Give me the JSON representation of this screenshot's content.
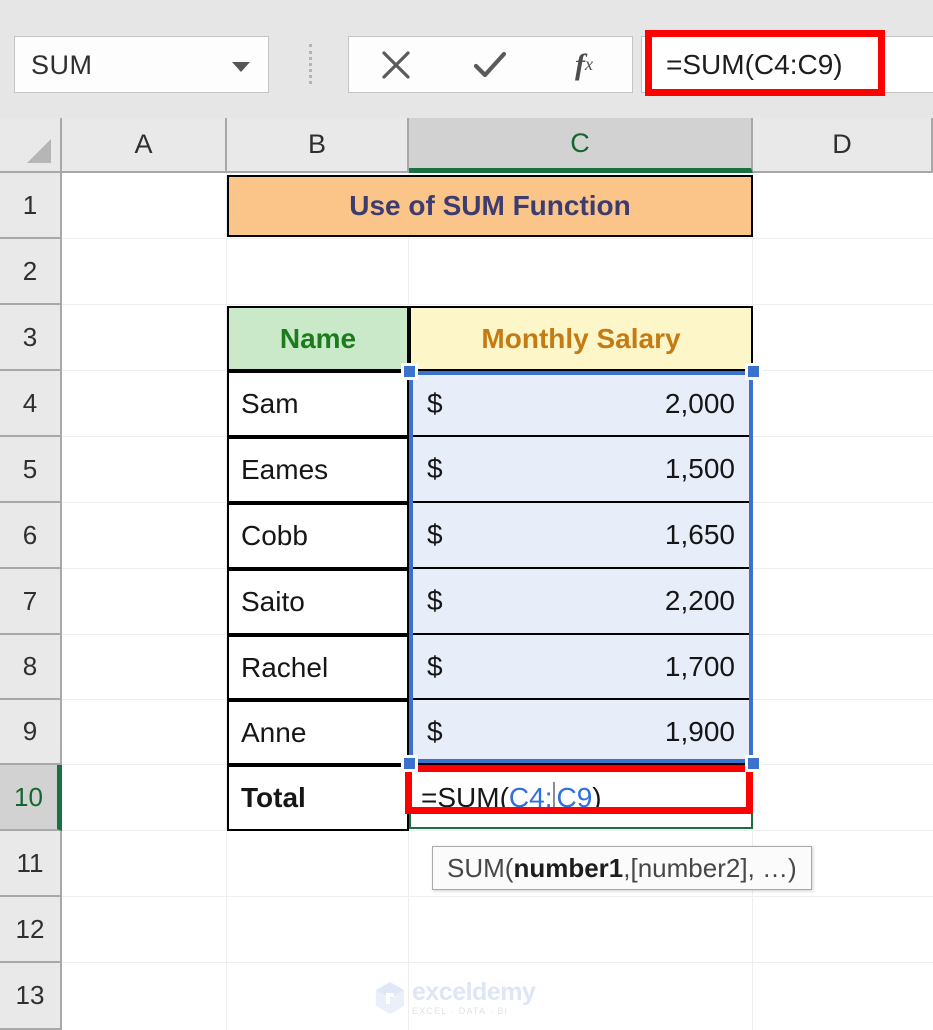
{
  "formula_bar": {
    "name_box_value": "SUM",
    "cancel_icon": "cancel-x-icon",
    "enter_icon": "enter-check-icon",
    "insert_function_icon": "fx-icon",
    "insert_function_label": "f",
    "insert_function_sub": "x",
    "formula_value": "=SUM(C4:C9)",
    "highlight_color": "#fd0000"
  },
  "grid": {
    "column_headers": [
      "A",
      "B",
      "C",
      "D"
    ],
    "selected_column": "C",
    "selected_column_accent": "#1b7040",
    "row_headers": [
      "1",
      "2",
      "3",
      "4",
      "5",
      "6",
      "7",
      "8",
      "9",
      "10",
      "11",
      "12",
      "13"
    ],
    "selected_row": "10",
    "corner_icon": "select-all-triangle-icon"
  },
  "sheet": {
    "title": "Use of SUM Function",
    "title_bg": "#fbc489",
    "title_color": "#3c3c70",
    "table": {
      "headers": [
        {
          "label": "Name",
          "bg": "#c9e9c9",
          "color": "#1d7a1d"
        },
        {
          "label": "Monthly Salary",
          "bg": "#fdf6c8",
          "color": "#c47b13"
        }
      ],
      "rows": [
        {
          "name": "Sam",
          "currency": "$",
          "amount": "2,000"
        },
        {
          "name": "Eames",
          "currency": "$",
          "amount": "1,500"
        },
        {
          "name": "Cobb",
          "currency": "$",
          "amount": "1,650"
        },
        {
          "name": "Saito",
          "currency": "$",
          "amount": "2,200"
        },
        {
          "name": "Rachel",
          "currency": "$",
          "amount": "1,700"
        },
        {
          "name": "Anne",
          "currency": "$",
          "amount": "1,900"
        }
      ],
      "total_label": "Total",
      "total_formula_prefix": "=SUM(",
      "total_formula_ref_start": "C4",
      "total_formula_colon": ":",
      "total_formula_ref_end": "C9",
      "total_formula_suffix": ")"
    },
    "selection_range": "C4:C9",
    "selection_color": "#3b72cd",
    "selection_fill": "#e7edf9"
  },
  "tooltip": {
    "prefix": "SUM(",
    "arg1": "number1",
    "mid": ", ",
    "arg2": "[number2]",
    "suffix": ", …)"
  },
  "watermark": {
    "name": "exceldemy",
    "tagline": "EXCEL · DATA · BI",
    "color": "#c3d2f2"
  }
}
